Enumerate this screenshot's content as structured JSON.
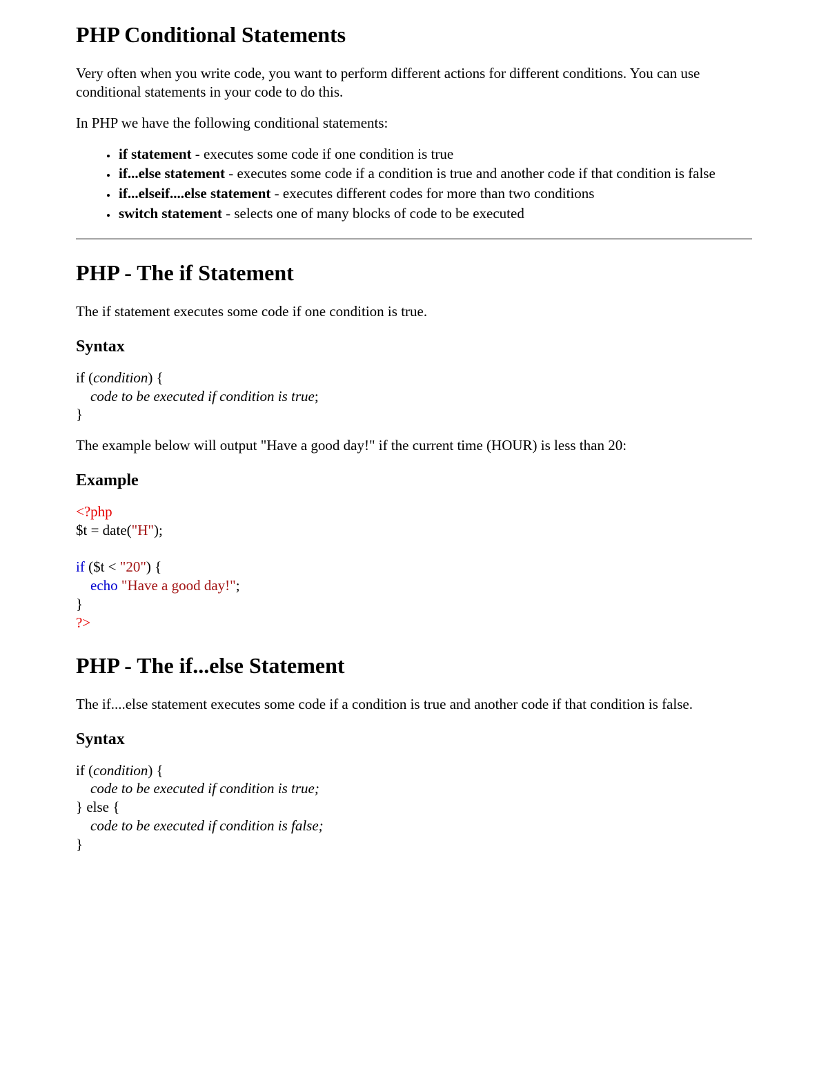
{
  "h1": {
    "title": "PHP Conditional Statements"
  },
  "intro": {
    "p1": "Very often when you write code, you want to perform different actions for different conditions. You can use conditional statements in your code to do this.",
    "p2": "In PHP we have the following conditional statements:"
  },
  "list": {
    "items": [
      {
        "bold": "if statement",
        "rest": " - executes some code if one condition is true"
      },
      {
        "bold": "if...else statement",
        "rest": " - executes some code if a condition is true and another code if that condition is false"
      },
      {
        "bold": "if...elseif....else statement",
        "rest": " - executes different codes for more than two conditions"
      },
      {
        "bold": "switch statement",
        "rest": " - selects one of many blocks of code to be executed"
      }
    ]
  },
  "sec_if": {
    "title": "PHP - The if Statement",
    "desc": "The if statement executes some code if one condition is true.",
    "syntax_h": "Syntax",
    "syntax": {
      "l1a": "if (",
      "l1b": "condition",
      "l1c": ") {",
      "l2": "code to be executed if condition is true",
      "l2tail": ";",
      "l3": "}"
    },
    "example_lead": "The example below will output \"Have a good day!\" if the current time (HOUR) is less than 20:",
    "example_h": "Example",
    "code": {
      "open": "<?php",
      "l2a": "$t = date(",
      "l2b": "\"H\"",
      "l2c": ");",
      "blank": "",
      "l4a": "if",
      "l4b": " ($t < ",
      "l4c": "\"20\"",
      "l4d": ") {",
      "l5a": "echo",
      "l5b": " ",
      "l5c": "\"Have a good day!\"",
      "l5d": ";",
      "l6": "}",
      "close": "?>"
    }
  },
  "sec_ifelse": {
    "title": "PHP - The if...else Statement",
    "desc": "The if....else statement executes some code if a condition is true and another code if that condition is false.",
    "syntax_h": "Syntax",
    "syntax": {
      "l1a": "if (",
      "l1b": "condition",
      "l1c": ") {",
      "l2": "code to be executed if condition is true;",
      "l3": "} else {",
      "l4": "code to be executed if condition is false;",
      "l5": "}"
    }
  }
}
